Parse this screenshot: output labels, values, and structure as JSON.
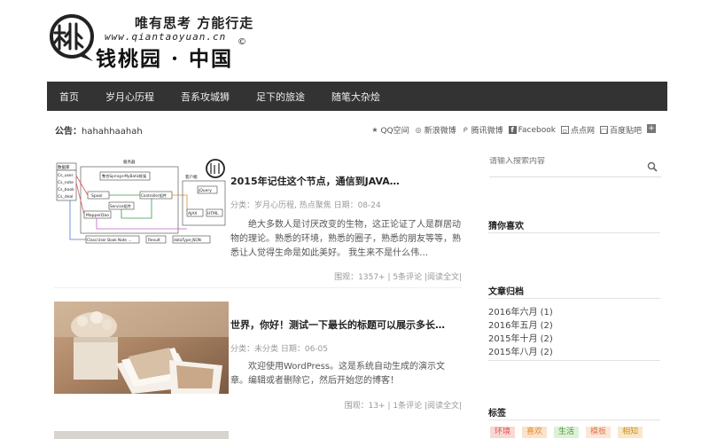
{
  "logo": {
    "slogan": "唯有思考 方能行走",
    "domain": "www.qiantaoyuan.cn",
    "site_name": "钱桃园 · 中国",
    "copyright": "©"
  },
  "nav": {
    "items": [
      "首页",
      "岁月心历程",
      "吾系攻城狮",
      "足下的旅途",
      "随笔大杂烩"
    ]
  },
  "notice": {
    "label": "公告：",
    "text": "hahahhaahah"
  },
  "share": [
    {
      "icon": "star-icon",
      "label": "QQ空间"
    },
    {
      "icon": "weibo-icon",
      "label": "新浪微博"
    },
    {
      "icon": "tencent-weibo-icon",
      "label": "腾讯微博"
    },
    {
      "icon": "facebook-icon",
      "label": "Facebook"
    },
    {
      "icon": "diandian-icon",
      "label": "点点网"
    },
    {
      "icon": "baidu-icon",
      "label": "百度贴吧"
    }
  ],
  "posts": [
    {
      "title": "2015年记住这个节点，通信到JAVA…",
      "meta": "分类：岁月心历程, 热点聚焦  日期：08-24",
      "excerpt": "绝大多数人是讨厌改变的生物，这正论证了人是群居动物的理论。熟悉的环境，熟悉的圈子，熟悉的朋友等等，熟悉让人觉得生命是如此美好。 我生来不是什么伟…",
      "stats": "围观：1357+ | 5条评论  |阅读全文|",
      "diagram_labels": {
        "table": "数据库",
        "fields": [
          "Cs_user",
          "Cs_note",
          "Cs_book",
          "Cs_deal"
        ],
        "server": "服务器",
        "framework": "整合Spring+MyBatis框架",
        "browser": "客户端",
        "spool": "Spool",
        "service": "Service组件",
        "controller": "Controller组件",
        "mapper": "MapperDao",
        "jquery": "jQuery",
        "ajax": "AJAX",
        "html": "HTML",
        "classes": "Class:User Book Note …",
        "result": "Result",
        "datatype": "dataType:JSON"
      }
    },
    {
      "title": "世界，你好！测试一下最长的标题可以展示多长…",
      "meta": "分类：未分类  日期：06-05",
      "excerpt": "欢迎使用WordPress。这是系统自动生成的演示文章。编辑或者删除它，然后开始您的博客！",
      "stats": "围观：13+ | 1条评论  |阅读全文|"
    }
  ],
  "sidebar": {
    "search_placeholder": "请输入搜索内容",
    "guess_title": "猜你喜欢",
    "archive_title": "文章归档",
    "archives": [
      "2016年六月 (1)",
      "2016年五月 (2)",
      "2015年十月 (2)",
      "2015年八月 (2)"
    ],
    "tags_title": "标签",
    "tags": [
      {
        "label": "环境",
        "bg": "#f7d9d2",
        "color": "#d9534f"
      },
      {
        "label": "喜欢",
        "bg": "#fbe3c9",
        "color": "#e08a2c"
      },
      {
        "label": "生活",
        "bg": "#dff0d8",
        "color": "#4a9a3c"
      },
      {
        "label": "模板",
        "bg": "#fde6d8",
        "color": "#e07a4a"
      },
      {
        "label": "相知",
        "bg": "#f9e8c8",
        "color": "#c9902a"
      }
    ]
  },
  "colors": {
    "nav_bg": "#333333",
    "nav_text": "#eeeeee"
  }
}
